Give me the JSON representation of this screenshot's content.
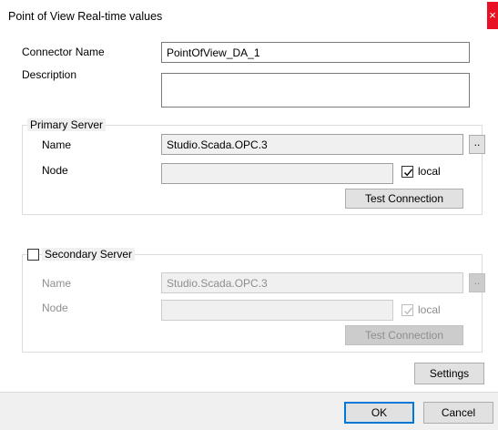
{
  "window": {
    "title": "Point of View Real-time values",
    "close_glyph": "×"
  },
  "connector": {
    "name_label": "Connector Name",
    "name_value": "PointOfView_DA_1",
    "description_label": "Description",
    "description_value": ""
  },
  "primary": {
    "legend": "Primary Server",
    "name_label": "Name",
    "name_value": "Studio.Scada.OPC.3",
    "browse_label": "..",
    "node_label": "Node",
    "node_value": "",
    "local_label": "local",
    "local_checked": true,
    "test_label": "Test Connection"
  },
  "secondary": {
    "legend": "Secondary Server",
    "enabled": false,
    "name_label": "Name",
    "name_value": "Studio.Scada.OPC.3",
    "browse_label": "..",
    "node_label": "Node",
    "node_value": "",
    "local_label": "local",
    "local_checked": true,
    "test_label": "Test Connection"
  },
  "buttons": {
    "settings_label": "Settings",
    "ok_label": "OK",
    "cancel_label": "Cancel"
  },
  "colors": {
    "close_red": "#e81123",
    "focus_blue": "#0078d7",
    "disabled_text": "#8e8e8e"
  }
}
